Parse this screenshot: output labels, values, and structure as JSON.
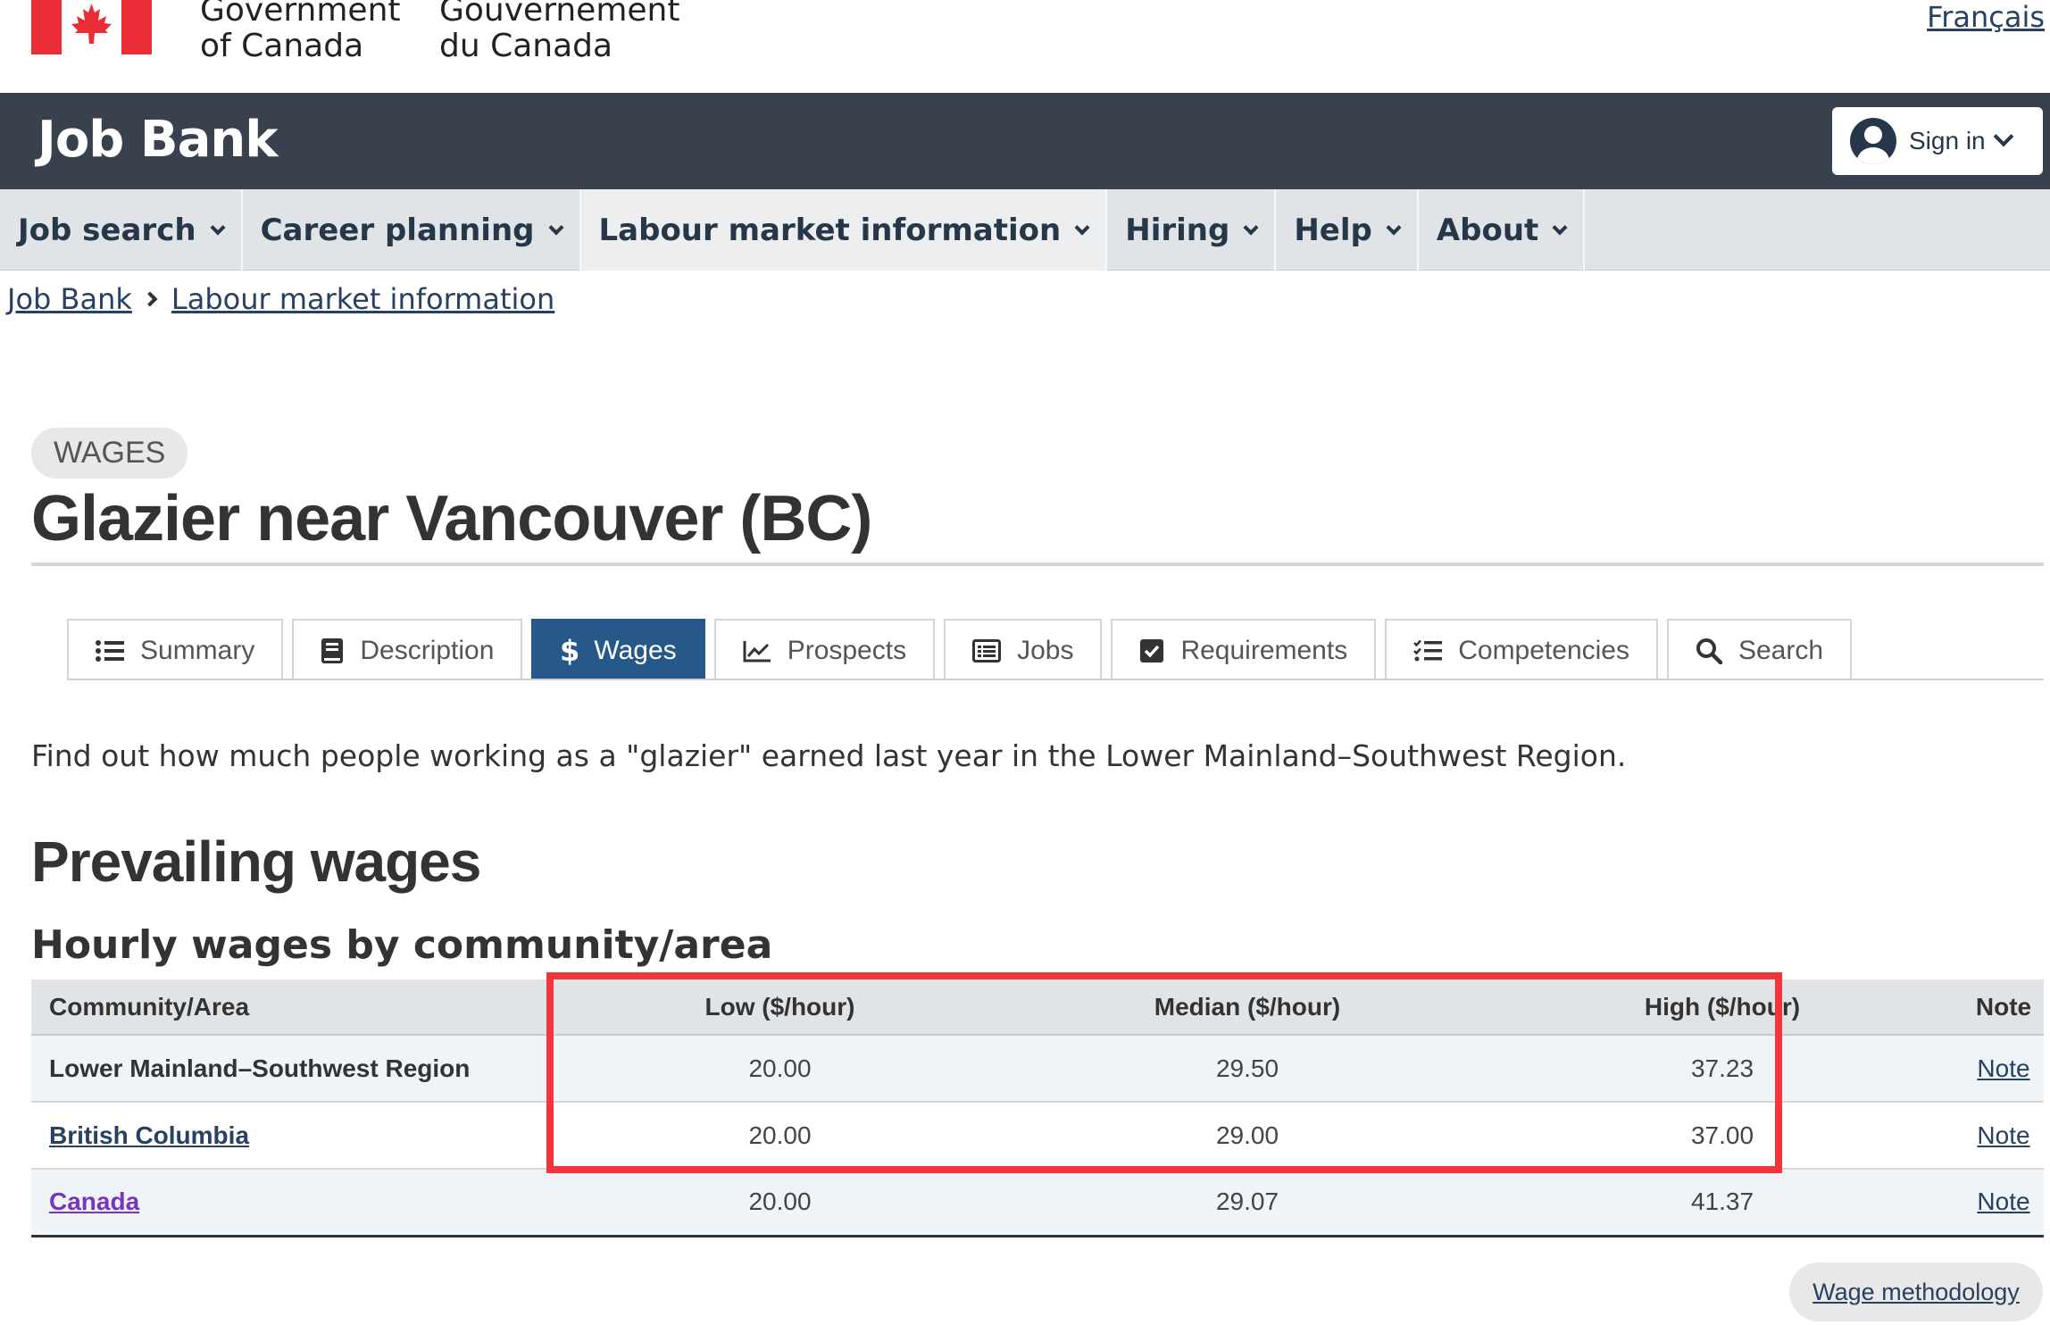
{
  "gov": {
    "sig_en_line1": "Government",
    "sig_en_line2": "of Canada",
    "sig_fr_line1": "Gouvernement",
    "sig_fr_line2": "du Canada",
    "lang_link": "Français",
    "flag_color": "#eb2d37"
  },
  "jobbank": {
    "title": "Job Bank",
    "signin_label": "Sign in"
  },
  "nav": {
    "items": [
      {
        "label": "Job search"
      },
      {
        "label": "Career planning"
      },
      {
        "label": "Labour market information"
      },
      {
        "label": "Hiring"
      },
      {
        "label": "Help"
      },
      {
        "label": "About"
      }
    ]
  },
  "breadcrumb": [
    "Job Bank",
    "Labour market information"
  ],
  "heading": {
    "badge": "WAGES",
    "title": "Glazier near Vancouver (BC)"
  },
  "tabs": [
    {
      "label": "Summary",
      "icon": "list-icon"
    },
    {
      "label": "Description",
      "icon": "book-icon"
    },
    {
      "label": "Wages",
      "icon": "dollar-icon",
      "active": true
    },
    {
      "label": "Prospects",
      "icon": "chart-line-icon"
    },
    {
      "label": "Jobs",
      "icon": "listings-icon"
    },
    {
      "label": "Requirements",
      "icon": "checkbox-icon"
    },
    {
      "label": "Competencies",
      "icon": "checklist-icon"
    },
    {
      "label": "Search",
      "icon": "search-icon"
    }
  ],
  "intro": "Find out how much people working as a \"glazier\" earned last year in the Lower Mainland–Southwest Region.",
  "section_title": "Prevailing wages",
  "table_title": "Hourly wages by community/area",
  "table": {
    "headers": [
      "Community/Area",
      "Low ($/hour)",
      "Median ($/hour)",
      "High ($/hour)",
      "Note"
    ],
    "rows": [
      {
        "area": "Lower Mainland–Southwest Region",
        "low": "20.00",
        "median": "29.50",
        "high": "37.23",
        "note": "Note"
      },
      {
        "area": "British Columbia",
        "low": "20.00",
        "median": "29.00",
        "high": "37.00",
        "note": "Note"
      },
      {
        "area": "Canada",
        "low": "20.00",
        "median": "29.07",
        "high": "41.37",
        "note": "Note"
      }
    ]
  },
  "wage_methodology": "Wage methodology",
  "colors": {
    "jobbank_bar": "#38414d",
    "active_tab": "#26598a",
    "highlight": "#f0353d",
    "link": "#284162",
    "visited_link": "#7834bc"
  }
}
